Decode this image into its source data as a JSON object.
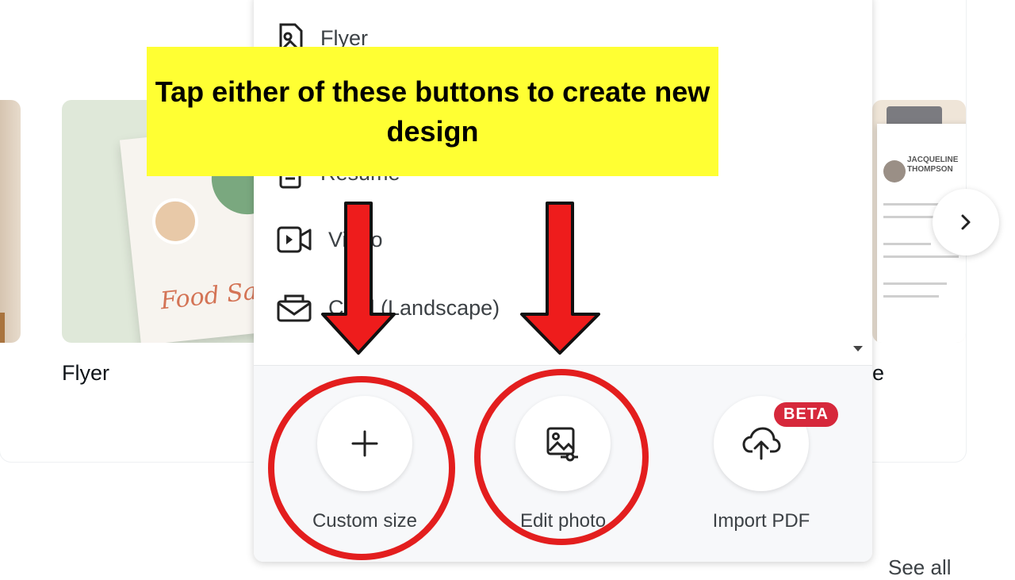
{
  "cards": {
    "flyer_label": "Flyer",
    "flyer_script": "Food Sale",
    "resume_label_tail": "e",
    "resume_name": "JACQUELINE THOMPSON"
  },
  "menu": {
    "items": [
      {
        "label": "Flyer",
        "icon": "flyer-icon"
      },
      {
        "label": "Resume",
        "icon": "resume-icon"
      },
      {
        "label": "Video",
        "icon": "video-icon"
      },
      {
        "label": "Card (Landscape)",
        "icon": "card-icon"
      }
    ]
  },
  "actions": {
    "custom_size": "Custom size",
    "edit_photo": "Edit photo",
    "import_pdf": "Import PDF",
    "beta_badge": "BETA"
  },
  "callout": {
    "text": "Tap either of these buttons to create new design"
  },
  "footer": {
    "cut_text": "See all"
  },
  "colors": {
    "callout_bg": "#ffff33",
    "annotation_red": "#e31e1e",
    "beta_red": "#d6283b"
  }
}
